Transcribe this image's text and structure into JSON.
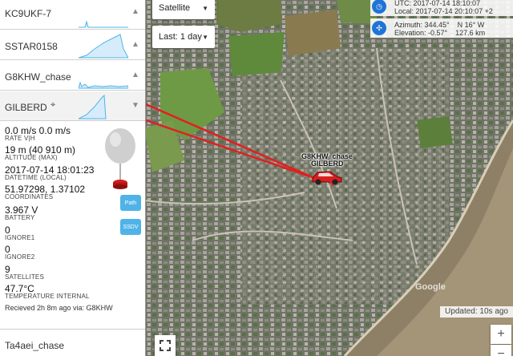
{
  "map": {
    "map_type": "Satellite",
    "time_range": "Last: 1 day",
    "utc_line": "UTC: 2017-07-14 18:10:07",
    "local_line": "Local: 2017-07-14 20:10:07 +2",
    "azimuth_line": "Azimuth: 344.45°",
    "direction": "N 16° W",
    "elevation_line": "Elevation: -0.57°",
    "distance": "127.6 km",
    "updated": "Updated: 10s ago",
    "zoom_in": "+",
    "zoom_out": "−",
    "label_chase": "G8KHW_chase",
    "label_payload": "GILBERD",
    "watermark": "Google",
    "colors": {
      "track": "#e02020",
      "accent": "#1f74d6",
      "button": "#4fb3e8"
    }
  },
  "sidebar": {
    "balloons": [
      {
        "name": "KC9UKF-7",
        "arrow": "▲"
      },
      {
        "name": "SSTAR0158",
        "arrow": "▲"
      },
      {
        "name": "G8KHW_chase",
        "arrow": "▲"
      },
      {
        "name": "GILBERD",
        "arrow": "▼",
        "target_icon": "⌖"
      }
    ],
    "details": {
      "rate": "0.0 m/s 0.0 m/s",
      "rate_label": "RATE V|H",
      "altitude": "19 m (40 910 m)",
      "altitude_label": "ALTITUDE (MAX)",
      "datetime": "2017-07-14 18:01:23",
      "datetime_label": "DATETIME (LOCAL)",
      "coordinates": "51.97298, 1.37102",
      "coordinates_label": "COORDINATES",
      "battery": "3.967 V",
      "battery_label": "BATTERY",
      "ignore1": "0",
      "ignore1_label": "IGNORE1",
      "ignore2": "0",
      "ignore2_label": "IGNORE2",
      "satellites": "9",
      "satellites_label": "SATELLITES",
      "temperature": "47.7°C",
      "temperature_label": "TEMPERATURE INTERNAL",
      "received": "Recieved 2h 8m ago via: G8KHW",
      "path_button": "Path",
      "ssdv_button": "SSDV"
    },
    "tail_item": "Ta4aei_chase"
  }
}
